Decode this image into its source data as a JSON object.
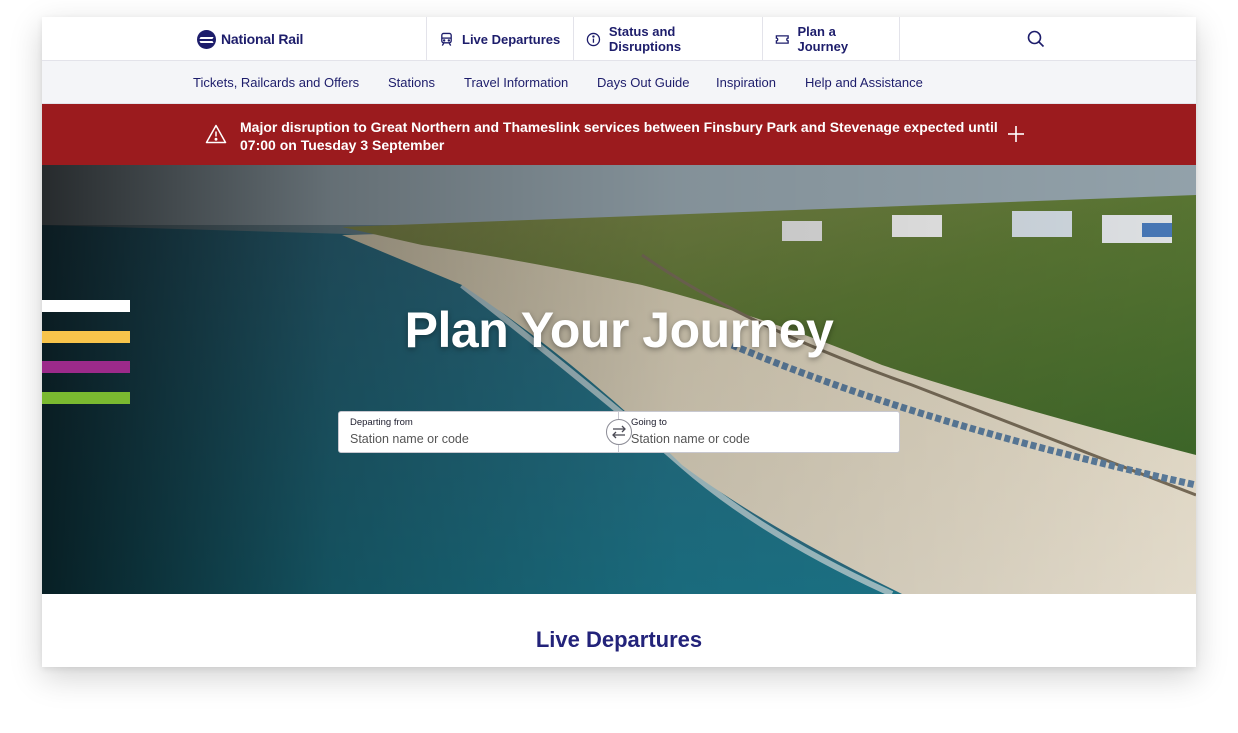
{
  "brand": {
    "name": "National Rail",
    "color": "#1d1d6b"
  },
  "top_tabs": [
    {
      "label": "Live Departures",
      "icon": "train-icon"
    },
    {
      "label": "Status and Disruptions",
      "icon": "info-icon"
    },
    {
      "label": "Plan a Journey",
      "icon": "ticket-icon"
    }
  ],
  "search": {
    "icon": "search-icon"
  },
  "subnav": [
    "Tickets, Railcards and Offers",
    "Stations",
    "Travel Information",
    "Days Out Guide",
    "Inspiration",
    "Help and Assistance"
  ],
  "alert": {
    "text": "Major disruption to Great Northern and Thameslink services between Finsbury Park and Stevenage expected until 07:00 on Tuesday 3 September",
    "color": "#9b1b1e",
    "icon": "warning-icon",
    "expand_icon": "plus-icon"
  },
  "hero": {
    "title": "Plan Your Journey",
    "stripes": [
      "#ffffff",
      "#f8c44b",
      "#9c2a8a",
      "#7ab930"
    ]
  },
  "journey_form": {
    "from_label": "Departing from",
    "from_placeholder": "Station name or code",
    "to_label": "Going to",
    "to_placeholder": "Station name or code",
    "swap_icon": "swap-arrows-icon"
  },
  "section": {
    "title": "Live Departures"
  }
}
